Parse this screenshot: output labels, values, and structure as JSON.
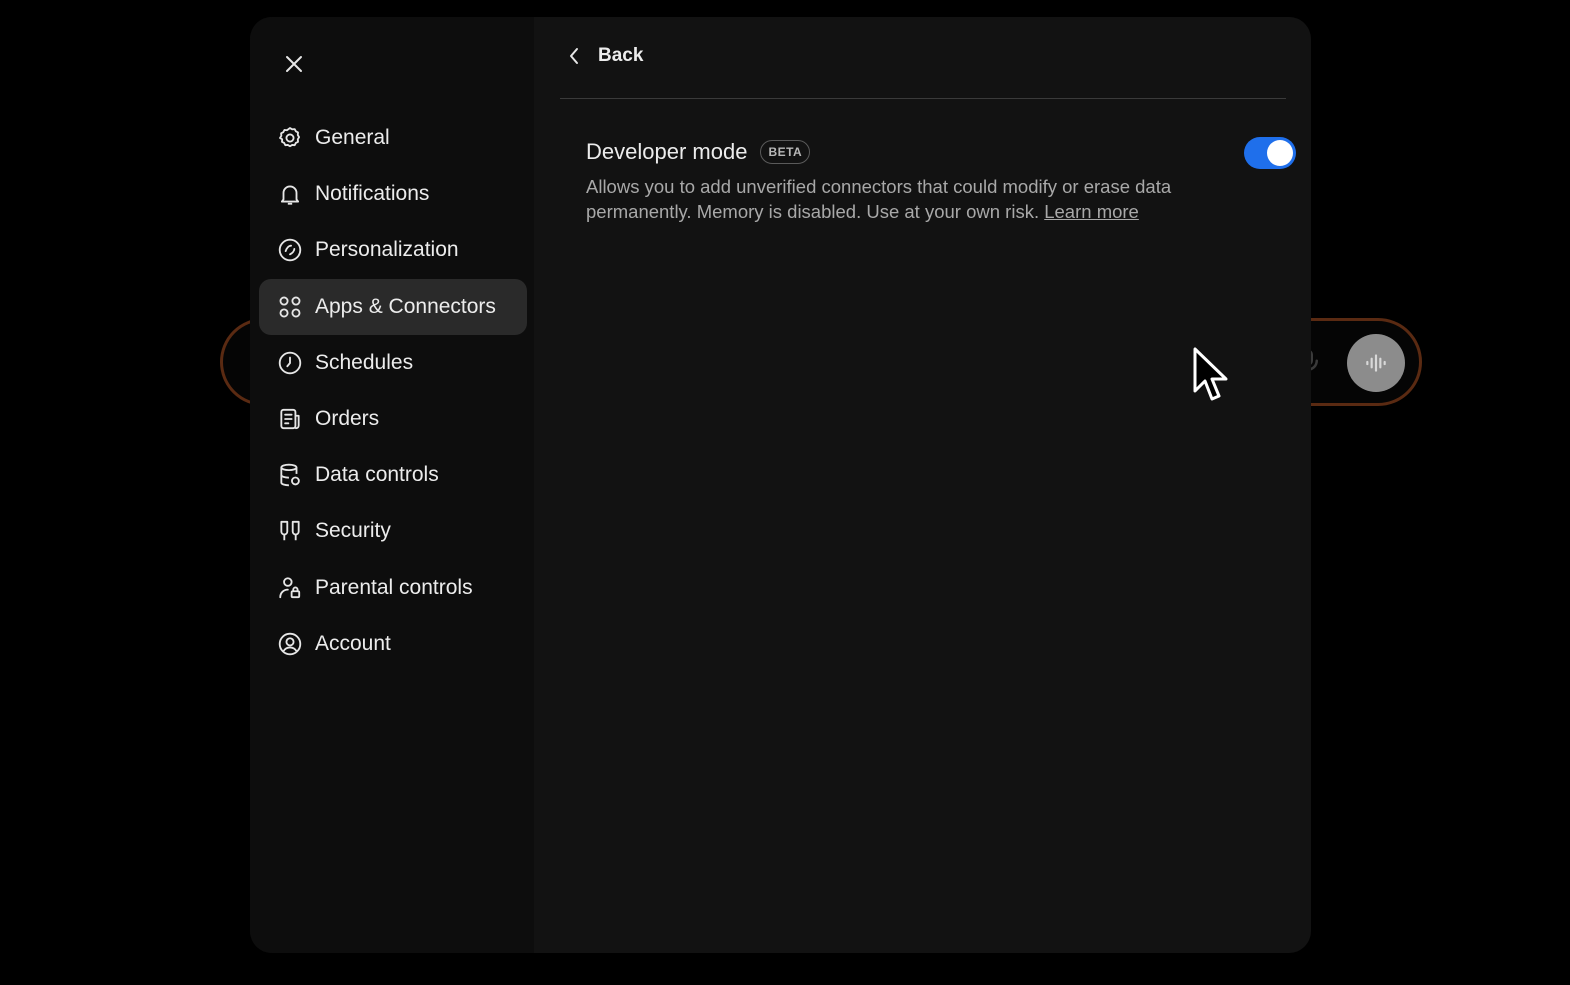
{
  "sidebar": {
    "close_label": "Close",
    "items": [
      {
        "label": "General",
        "icon": "gear-icon"
      },
      {
        "label": "Notifications",
        "icon": "bell-icon"
      },
      {
        "label": "Personalization",
        "icon": "personalization-icon"
      },
      {
        "label": "Apps & Connectors",
        "icon": "apps-icon",
        "active": true
      },
      {
        "label": "Schedules",
        "icon": "clock-icon"
      },
      {
        "label": "Orders",
        "icon": "orders-icon"
      },
      {
        "label": "Data controls",
        "icon": "database-icon"
      },
      {
        "label": "Security",
        "icon": "security-icon"
      },
      {
        "label": "Parental controls",
        "icon": "parental-icon"
      },
      {
        "label": "Account",
        "icon": "account-icon"
      }
    ]
  },
  "header": {
    "back_label": "Back"
  },
  "setting": {
    "title": "Developer mode",
    "badge": "BETA",
    "description": "Allows you to add unverified connectors that could modify or erase data permanently. Memory is disabled. Use at your own risk.",
    "link_label": "Learn more",
    "enabled": true
  },
  "colors": {
    "toggle_on": "#1f6feb",
    "modal_bg": "#121212",
    "sidebar_bg": "#0d0d0d",
    "active_item_bg": "#2a2a2a",
    "composer_border": "#5a2a12"
  }
}
